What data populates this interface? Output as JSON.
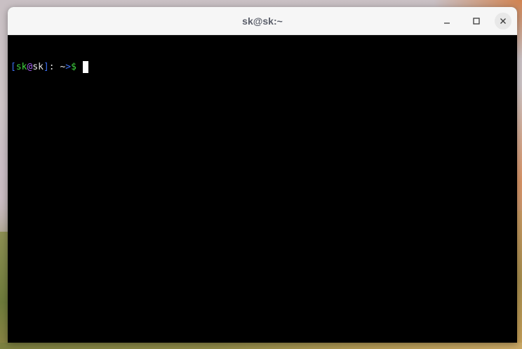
{
  "window": {
    "title": "sk@sk:~"
  },
  "controls": {
    "minimize_icon": "minimize-icon",
    "maximize_icon": "maximize-icon",
    "close_icon": "close-icon"
  },
  "terminal": {
    "prompt": {
      "open_bracket": "[",
      "user": "sk",
      "at": "@",
      "host": "sk",
      "close_bracket": "]",
      "colon": ":",
      "cwd": " ~",
      "arrow": ">",
      "symbol": "$",
      "spacer": " "
    },
    "input_text": ""
  },
  "colors": {
    "terminal_bg": "#000000",
    "prompt_bracket": "#3b6ff0",
    "prompt_user": "#3fd33f",
    "prompt_at": "#a060e8",
    "titlebar_bg": "#f6f6f6",
    "title_text": "#5b5f6a"
  }
}
